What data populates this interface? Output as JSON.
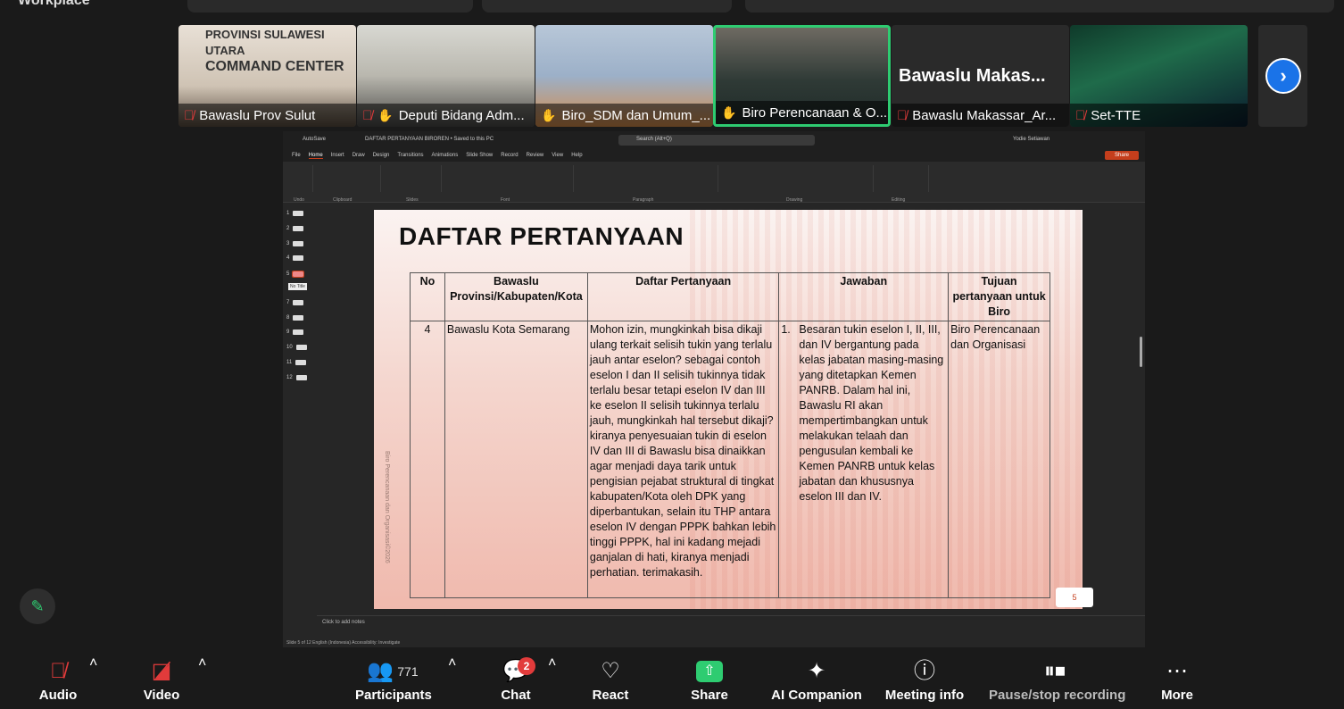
{
  "app": {
    "name": "Workplace"
  },
  "participants_strip": {
    "tiles": [
      {
        "name": "Bawaslu Prov Sulut",
        "muted": true,
        "hand": false,
        "banner": [
          "PROVINSI SULAWESI UTARA",
          "COMMAND CENTER"
        ]
      },
      {
        "name": "Deputi Bidang Adm...",
        "muted": true,
        "hand": true
      },
      {
        "name": "Biro_SDM dan Umum_...",
        "muted": false,
        "hand": true
      },
      {
        "name": "Biro Perencanaan & O...",
        "muted": false,
        "hand": true,
        "active": true
      },
      {
        "name": "Bawaslu Makassar_Ar...",
        "muted": true,
        "hand": false,
        "big_name": "Bawaslu  Makas..."
      },
      {
        "name": "Set-TTE",
        "muted": true,
        "hand": false
      }
    ]
  },
  "ppt": {
    "autosave": "AutoSave",
    "doc_title": "DAFTAR PERTANYAAN BIROREN • Saved to this PC",
    "search_placeholder": "Search (Alt+Q)",
    "user": "Yodie Setiawan",
    "tabs": [
      "File",
      "Home",
      "Insert",
      "Draw",
      "Design",
      "Transitions",
      "Animations",
      "Slide Show",
      "Record",
      "Review",
      "View",
      "Help"
    ],
    "share": "Share",
    "ribbon_groups": [
      "Undo",
      "Clipboard",
      "Slides",
      "Font",
      "Paragraph",
      "Drawing",
      "Editing"
    ],
    "thumbnails": [
      "1",
      "2",
      "3",
      "4",
      "5",
      "7",
      "8",
      "9",
      "10",
      "11",
      "12"
    ],
    "tooltip": "No Title",
    "notes_placeholder": "Click to add notes",
    "status": "Slide 5 of 12    English (Indonesia)    Accessibility: Investigate"
  },
  "slide": {
    "title": "DAFTAR PERTANYAAN",
    "side_text": "Biro Perencanaan dan Organisasi©2026",
    "headers": {
      "no": "No",
      "prov": "Bawaslu Provinsi/Kabupaten/Kota",
      "question": "Daftar Pertanyaan",
      "answer": "Jawaban",
      "goal": "Tujuan pertanyaan untuk Biro"
    },
    "row": {
      "no": "4",
      "prov": "Bawaslu Kota Semarang",
      "question": "Mohon izin, mungkinkah bisa dikaji ulang terkait selisih tukin yang terlalu jauh antar eselon? sebagai contoh eselon I dan II selisih tukinnya tidak terlalu besar tetapi eselon IV dan III ke eselon II selisih tukinnya terlalu jauh, mungkinkah hal tersebut dikaji? kiranya penyesuaian tukin di eselon IV dan III di Bawaslu bisa dinaikkan agar menjadi daya tarik untuk pengisian pejabat struktural di tingkat kabupaten/Kota oleh DPK yang diperbantukan, selain itu THP antara eselon IV dengan PPPK bahkan lebih tinggi PPPK, hal ini kadang mejadi ganjalan di hati, kiranya menjadi perhatian. terimakasih.",
      "answer_num": "1.",
      "answer": "Besaran tukin eselon I, II, III, dan IV bergantung pada kelas jabatan masing-masing yang ditetapkan Kemen PANRB. Dalam hal ini, Bawaslu RI akan mempertimbangkan untuk melakukan telaah dan pengusulan kembali ke Kemen PANRB untuk kelas jabatan dan khususnya eselon III dan IV.",
      "goal": "Biro Perencanaan dan Organisasi"
    },
    "page_number": "5"
  },
  "controls": {
    "audio": "Audio",
    "video": "Video",
    "participants": "Participants",
    "participants_count": "771",
    "chat": "Chat",
    "chat_badge": "2",
    "react": "React",
    "share": "Share",
    "ai": "AI Companion",
    "info": "Meeting info",
    "record": "Pause/stop recording",
    "more": "More"
  },
  "colors": {
    "active_border": "#2ecc71",
    "share_green": "#2ecc71",
    "muted_red": "#e23b3b",
    "ppt_accent": "#c43e1c",
    "next_blue": "#1a73e8"
  }
}
